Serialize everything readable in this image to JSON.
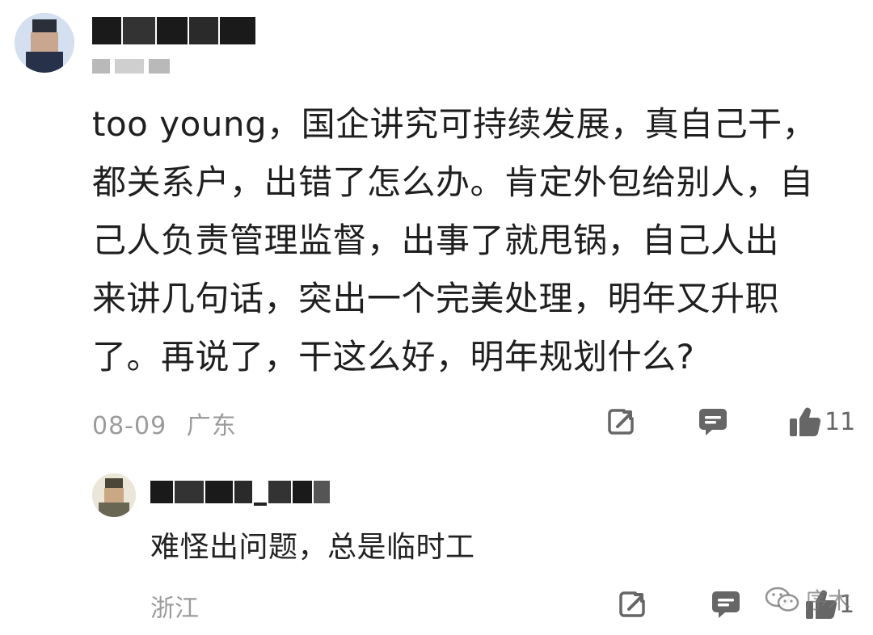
{
  "main_comment": {
    "username": "",
    "text": "too young，国企讲究可持续发展，真自己干，\n都关系户，出错了怎么办。肯定外包给别人，自\n己人负责管理监督，出事了就甩锅，自己人出\n来讲几句话，突出一个完美处理，明年又升职\n了。再说了，干这么好，明年规划什么?",
    "date": "08-09",
    "location": "广东",
    "like_count": "11"
  },
  "reply": {
    "username": "",
    "text": "难怪出问题，总是临时工",
    "location": "浙江",
    "like_count": "1"
  },
  "watermark": {
    "text": "序木"
  },
  "icons": {
    "share": "share-icon",
    "reply": "comment-icon",
    "like": "thumbs-up-icon",
    "watermark": "wechat-icon"
  },
  "colors": {
    "text": "#1f1f1f",
    "meta": "#9b9b9b",
    "icon": "#666666"
  }
}
